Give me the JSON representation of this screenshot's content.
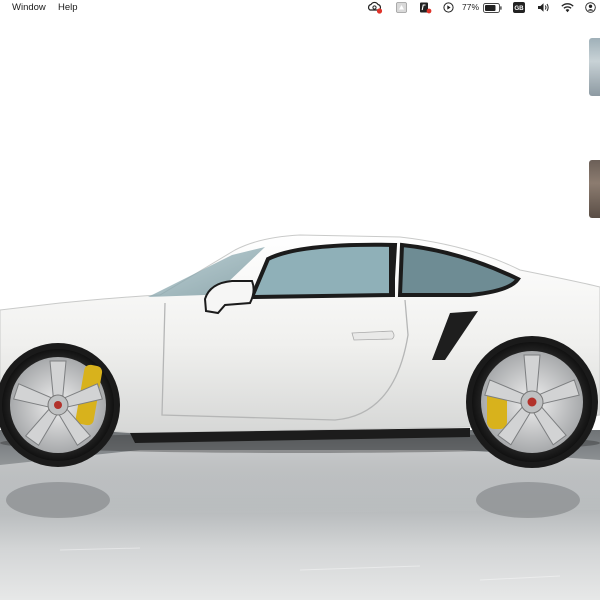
{
  "menubar": {
    "menus": [
      "Window",
      "Help"
    ],
    "battery_percent": "77%",
    "keyboard_layout": "GB",
    "status_icons": [
      "creative-cloud-icon",
      "drive-icon",
      "pdf-icon",
      "play-icon",
      "battery-icon",
      "keyboard-layout-icon",
      "volume-icon",
      "wifi-icon",
      "user-icon"
    ]
  },
  "desktop": {
    "wallpaper": "white-sports-car",
    "car_color": "#f2f2f0",
    "caliper_color": "#d8b21c"
  },
  "colors": {
    "menubar_text": "#1a1a1a",
    "notification_red": "#e0332a",
    "floor": "#6e7275"
  }
}
